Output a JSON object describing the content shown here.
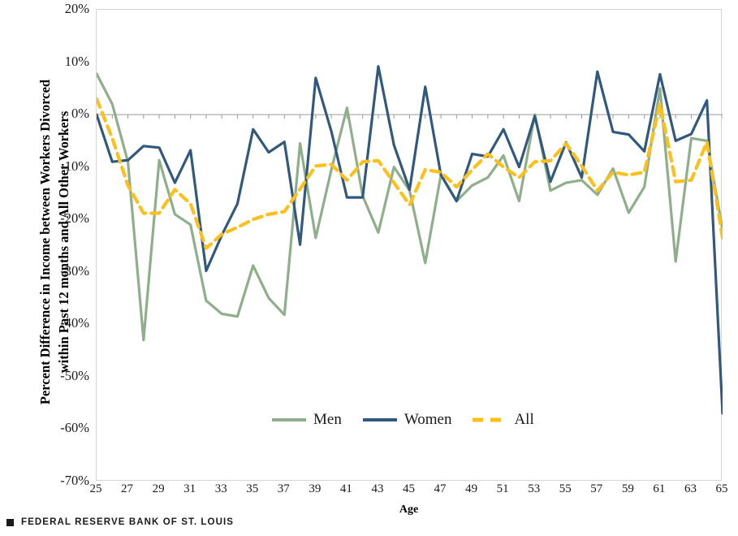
{
  "footer": {
    "mark_icon": "square-mark-icon",
    "text": "FEDERAL RESERVE BANK OF ST. LOUIS"
  },
  "legend": {
    "position": "bottom-center",
    "items": [
      {
        "label": "Men",
        "color": "#8FAF8B",
        "style": "solid"
      },
      {
        "label": "Women",
        "color": "#31597E",
        "style": "solid"
      },
      {
        "label": "All",
        "color": "#FCC01C",
        "style": "dashed"
      }
    ]
  },
  "axes": {
    "y_title": "Percent Difference in Income between Workers Divorced\nwithin Past 12 months and All Other Workers",
    "y_ticks": [
      "20%",
      "10%",
      "0%",
      "-10%",
      "-20%",
      "-30%",
      "-40%",
      "-50%",
      "-60%",
      "-70%"
    ],
    "x_title": "Age",
    "x_ticks": [
      "25",
      "27",
      "29",
      "31",
      "33",
      "35",
      "37",
      "39",
      "41",
      "43",
      "45",
      "47",
      "49",
      "51",
      "53",
      "55",
      "57",
      "59",
      "61",
      "63",
      "65"
    ]
  },
  "chart_data": {
    "type": "line",
    "title": "",
    "subtitle": "",
    "xlabel": "Age",
    "ylabel": "Percent Difference in Income between Workers Divorced within Past 12 months and All Other Workers",
    "xlim": [
      25,
      65
    ],
    "ylim": [
      -70,
      20
    ],
    "y_tick_values": [
      20,
      10,
      0,
      -10,
      -20,
      -30,
      -40,
      -50,
      -60,
      -70
    ],
    "y_unit": "percent",
    "grid": false,
    "zero_line": true,
    "legend_position": "bottom-center",
    "x": [
      25,
      26,
      27,
      28,
      29,
      30,
      31,
      32,
      33,
      34,
      35,
      36,
      37,
      38,
      39,
      40,
      41,
      42,
      43,
      44,
      45,
      46,
      47,
      48,
      49,
      50,
      51,
      52,
      53,
      54,
      55,
      56,
      57,
      58,
      59,
      60,
      61,
      62,
      63,
      64,
      65
    ],
    "series": [
      {
        "name": "Men",
        "color": "#8FAF8B",
        "style": "solid",
        "values": [
          7.8,
          2.0,
          -9.0,
          -43.0,
          -8.7,
          -19.0,
          -21.0,
          -35.5,
          -38.0,
          -38.5,
          -28.8,
          -35.0,
          -38.2,
          -5.5,
          -23.5,
          -10.5,
          1.3,
          -15.5,
          -22.5,
          -10.0,
          -14.5,
          -28.3,
          -11.5,
          -16.5,
          -13.5,
          -12.0,
          -7.8,
          -16.5,
          0.0,
          -14.5,
          -13.0,
          -12.5,
          -15.3,
          -10.3,
          -18.7,
          -13.8,
          5.0,
          -28.0,
          -4.5,
          -5.0,
          -22.0
        ]
      },
      {
        "name": "Women",
        "color": "#31597E",
        "style": "solid",
        "values": [
          0.0,
          -9.0,
          -8.7,
          -6.0,
          -6.3,
          -13.0,
          -6.8,
          -29.8,
          -23.0,
          -17.0,
          -2.8,
          -7.2,
          -5.2,
          -24.8,
          7.0,
          -3.2,
          -15.8,
          -15.8,
          9.2,
          -5.8,
          -14.3,
          5.3,
          -11.5,
          -16.5,
          -7.5,
          -8.0,
          -2.8,
          -10.0,
          -0.3,
          -12.8,
          -5.3,
          -12.0,
          8.2,
          -3.3,
          -3.8,
          -7.0,
          7.7,
          -5.0,
          -3.7,
          2.7,
          -57.0
        ]
      },
      {
        "name": "All",
        "color": "#FCC01C",
        "style": "dashed",
        "values": [
          3.0,
          -4.5,
          -13.5,
          -18.8,
          -18.8,
          -14.3,
          -17.0,
          -25.5,
          -22.8,
          -21.5,
          -20.0,
          -19.0,
          -18.5,
          -14.2,
          -9.8,
          -9.5,
          -12.5,
          -9.0,
          -8.8,
          -13.0,
          -17.2,
          -10.5,
          -11.0,
          -13.8,
          -10.5,
          -7.5,
          -10.0,
          -12.0,
          -9.0,
          -8.8,
          -5.5,
          -9.8,
          -14.5,
          -11.0,
          -11.5,
          -11.0,
          2.0,
          -12.8,
          -12.5,
          -5.2,
          -23.5
        ]
      }
    ]
  }
}
